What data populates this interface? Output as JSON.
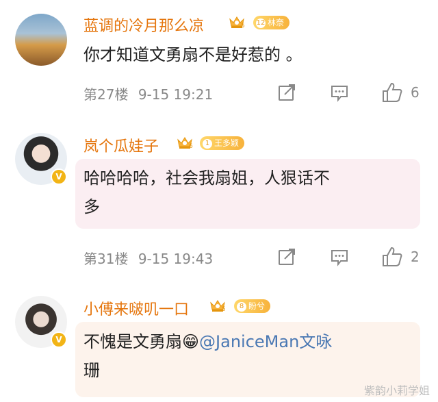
{
  "comments": [
    {
      "username": "蓝调的冷月那么凉",
      "crown_level": "5",
      "fan_level": "12",
      "fan_group": "林奈",
      "text": "你才知道文勇扇不是好惹的 。",
      "floor": "第27楼",
      "time": "9-15 19:21",
      "likes": "6"
    },
    {
      "username": "岚个瓜娃子",
      "crown_level": "6",
      "fan_level": "1",
      "fan_group": "王多颖",
      "text_line1": "哈哈哈哈，社会我扇姐，人狠话不",
      "text_line2": "多",
      "floor": "第31楼",
      "time": "9-15 19:43",
      "likes": "2"
    },
    {
      "username": "小傅来啵叽一口",
      "crown_level": "5",
      "fan_level": "8",
      "fan_group": "盼兮",
      "text_part1": "不愧是文勇扇",
      "emoji": "😁",
      "mention": "@JaniceMan文咏",
      "text_line2": "珊"
    }
  ],
  "watermark": "紫韵小莉学姐",
  "colors": {
    "username": "#e5760e",
    "bubble": "#fbeef2",
    "meta": "#888888",
    "mention": "#4a78b3"
  },
  "icons": [
    "verified-badge-icon",
    "crown-icon",
    "share-icon",
    "comment-icon",
    "like-icon"
  ]
}
